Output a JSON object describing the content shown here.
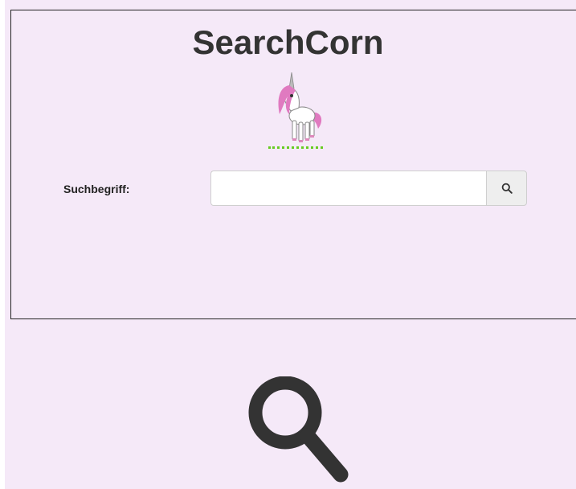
{
  "app": {
    "title": "SearchCorn"
  },
  "search": {
    "label": "Suchbegriff:",
    "value": "",
    "placeholder": ""
  },
  "icons": {
    "logo": "unicorn-icon",
    "search_button": "search-icon",
    "large": "magnifier-icon"
  },
  "colors": {
    "background": "#f5e9f8",
    "title_text": "#333333",
    "dotted_accent": "#66cc22",
    "unicorn_mane": "#e07ac0"
  }
}
